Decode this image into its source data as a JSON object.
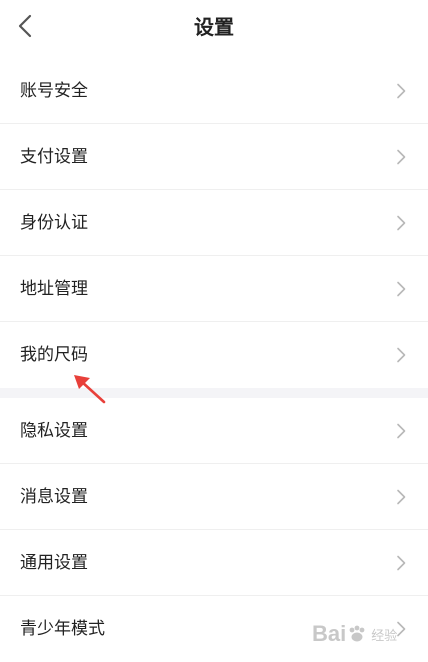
{
  "header": {
    "title": "设置",
    "back_icon": "chevron-left-icon"
  },
  "groups": [
    {
      "items": [
        {
          "label": "账号安全",
          "icon": "chevron-right-icon"
        },
        {
          "label": "支付设置",
          "icon": "chevron-right-icon"
        },
        {
          "label": "身份认证",
          "icon": "chevron-right-icon"
        },
        {
          "label": "地址管理",
          "icon": "chevron-right-icon"
        },
        {
          "label": "我的尺码",
          "icon": "chevron-right-icon"
        }
      ]
    },
    {
      "items": [
        {
          "label": "隐私设置",
          "icon": "chevron-right-icon"
        },
        {
          "label": "消息设置",
          "icon": "chevron-right-icon"
        },
        {
          "label": "通用设置",
          "icon": "chevron-right-icon"
        },
        {
          "label": "青少年模式",
          "icon": "chevron-right-icon"
        }
      ]
    }
  ],
  "annotation": {
    "icon": "red-arrow-icon",
    "color": "#e8403a"
  },
  "watermark": {
    "text": "Bai",
    "sub": "经验"
  },
  "colors": {
    "text": "#222222",
    "chevron": "#b8b8b8",
    "divider": "#efefef",
    "group_gap": "#f4f4f7"
  }
}
